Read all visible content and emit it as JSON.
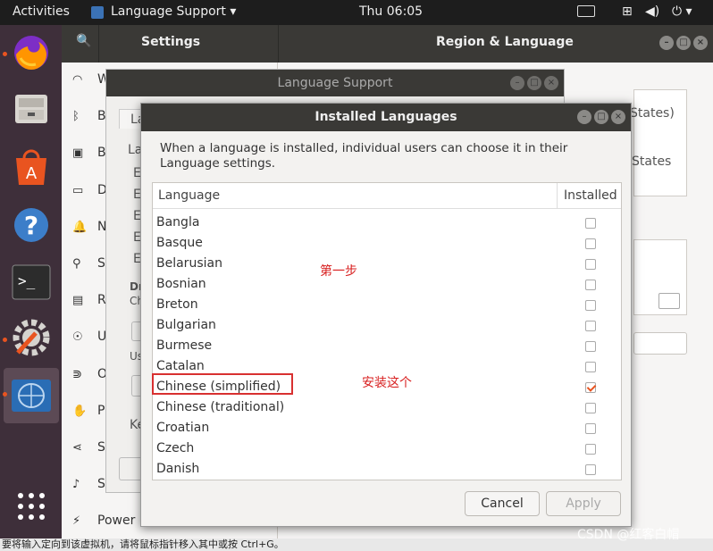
{
  "topbar": {
    "activities": "Activities",
    "app_menu": "Language Support",
    "clock": "Thu 06:05"
  },
  "settings": {
    "title": "Settings",
    "panel_title": "Region & Language",
    "sidebar_items": [
      {
        "label": "Wi",
        "icon": "wifi-icon"
      },
      {
        "label": "Bl",
        "icon": "bluetooth-icon"
      },
      {
        "label": "Ba",
        "icon": "background-icon"
      },
      {
        "label": "Do",
        "icon": "dock-icon"
      },
      {
        "label": "No",
        "icon": "bell-icon"
      },
      {
        "label": "Se",
        "icon": "search-icon"
      },
      {
        "label": "Re",
        "icon": "region-icon"
      },
      {
        "label": "Un",
        "icon": "accessibility-icon"
      },
      {
        "label": "On",
        "icon": "sharing-icon"
      },
      {
        "label": "Pr",
        "icon": "privacy-icon"
      },
      {
        "label": "Sh",
        "icon": "share-icon"
      },
      {
        "label": "So",
        "icon": "sound-icon"
      },
      {
        "label": "Power",
        "icon": "power-icon"
      }
    ],
    "bg_text_1": "States)",
    "bg_text_2": "States"
  },
  "language_support": {
    "title": "Language Support",
    "tab_fragment": "La",
    "label_fragment": "La",
    "items_fragment": [
      "E",
      "E",
      "E",
      "E",
      "E"
    ],
    "fragment_dr": "Dr",
    "fragment_ch": "Ch",
    "fragment_us": "Us",
    "fragment_ke": "Ke"
  },
  "dialog": {
    "title": "Installed Languages",
    "description": "When a language is installed, individual users can choose it in their Language settings.",
    "col_language": "Language",
    "col_installed": "Installed",
    "rows": [
      {
        "name": "Bangla",
        "installed": false
      },
      {
        "name": "Basque",
        "installed": false
      },
      {
        "name": "Belarusian",
        "installed": false
      },
      {
        "name": "Bosnian",
        "installed": false
      },
      {
        "name": "Breton",
        "installed": false
      },
      {
        "name": "Bulgarian",
        "installed": false
      },
      {
        "name": "Burmese",
        "installed": false
      },
      {
        "name": "Catalan",
        "installed": false
      },
      {
        "name": "Chinese (simplified)",
        "installed": true
      },
      {
        "name": "Chinese (traditional)",
        "installed": false
      },
      {
        "name": "Croatian",
        "installed": false
      },
      {
        "name": "Czech",
        "installed": false
      },
      {
        "name": "Danish",
        "installed": false
      }
    ],
    "cancel_label": "Cancel",
    "apply_label": "Apply"
  },
  "annotations": {
    "step1": "第一步",
    "install_this": "安装这个"
  },
  "status_bar": "要将输入定向到该虚拟机，请将鼠标指针移入其中或按 Ctrl+G。",
  "watermark": "CSDN @红客白帽",
  "colors": {
    "accent": "#e95420",
    "highlight": "#d83030",
    "dock": "#3e2f3a",
    "header": "#3a3936"
  }
}
